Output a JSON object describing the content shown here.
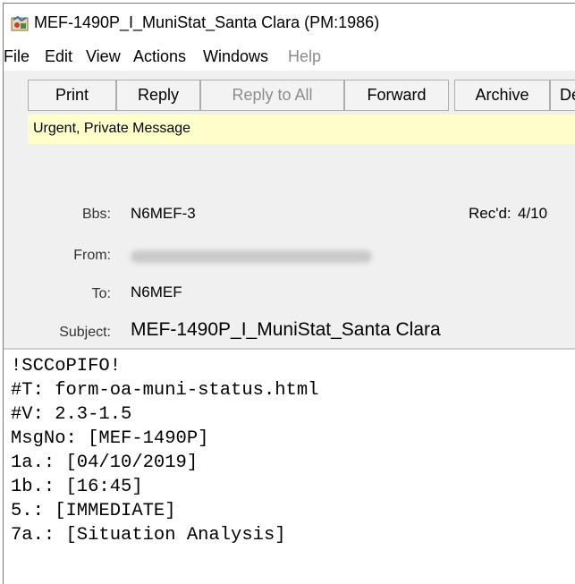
{
  "window": {
    "title": "MEF-1490P_I_MuniStat_Santa Clara  (PM:1986)",
    "icon": "outpost-app-icon"
  },
  "menu": [
    {
      "label": "File",
      "enabled": true
    },
    {
      "label": "Edit",
      "enabled": true
    },
    {
      "label": "View",
      "enabled": true
    },
    {
      "label": "Actions",
      "enabled": true
    },
    {
      "label": "Windows",
      "enabled": true
    },
    {
      "label": "Help",
      "enabled": false
    }
  ],
  "toolbar": [
    {
      "label": "Print",
      "enabled": true
    },
    {
      "label": "Reply",
      "enabled": true
    },
    {
      "label": "Reply to All",
      "enabled": false
    },
    {
      "label": "Forward",
      "enabled": true
    },
    {
      "label": "Archive",
      "enabled": true
    },
    {
      "label": "De",
      "enabled": true
    }
  ],
  "banner": {
    "text": "Urgent, Private Message",
    "color": "#ffffcc"
  },
  "headers": {
    "bbs_label": "Bbs:",
    "bbs_value": "N6MEF-3",
    "recd_label": "Rec'd:",
    "recd_value": "4/10",
    "from_label": "From:",
    "to_label": "To:",
    "to_value": "N6MEF",
    "subject_label": "Subject:",
    "subject_value": "MEF-1490P_I_MuniStat_Santa Clara"
  },
  "body_lines": [
    "!SCCoPIFO!",
    "#T: form-oa-muni-status.html",
    "#V: 2.3-1.5",
    "MsgNo: [MEF-1490P]",
    "1a.: [04/10/2019]",
    "1b.: [16:45]",
    "5.: [IMMEDIATE]",
    "7a.: [Situation Analysis]"
  ]
}
